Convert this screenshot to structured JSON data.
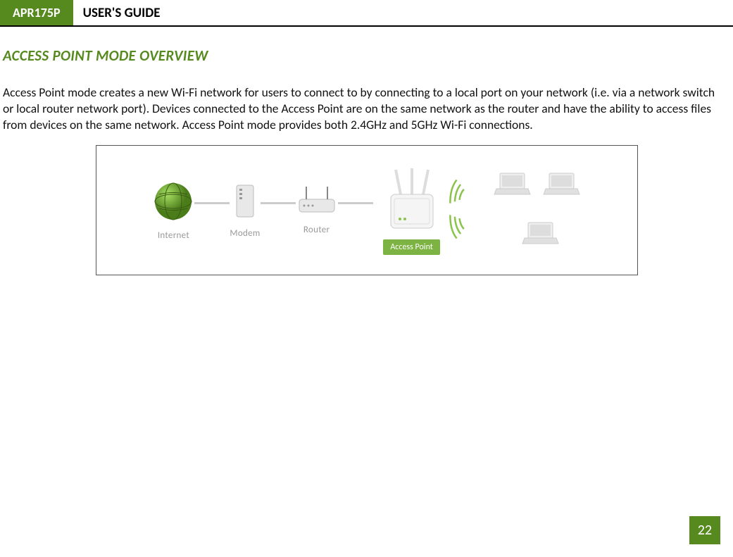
{
  "header": {
    "badge": "APR175P",
    "title": "USER'S GUIDE"
  },
  "section": {
    "title": "ACCESS POINT MODE OVERVIEW"
  },
  "body": {
    "paragraph": "Access Point mode creates a new Wi-Fi network for users to connect to by connecting to a local port on your network (i.e. via a network switch or local router network port). Devices connected to the Access Point are on the same network as the router and have the ability to access files from devices on the same network. Access Point mode provides both 2.4GHz and 5GHz Wi-Fi connections."
  },
  "diagram": {
    "internet_label": "Internet",
    "modem_label": "Modem",
    "router_label": "Router",
    "ap_label": "Access Point"
  },
  "page_number": "22"
}
